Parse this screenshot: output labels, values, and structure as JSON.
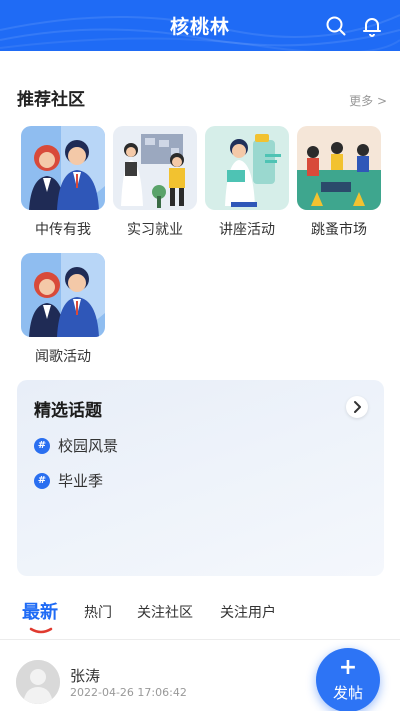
{
  "header": {
    "title": "核桃林"
  },
  "recommended": {
    "title": "推荐社区",
    "more": "更多 >",
    "items": [
      {
        "label": "中传有我"
      },
      {
        "label": "实习就业"
      },
      {
        "label": "讲座活动"
      },
      {
        "label": "跳蚤市场"
      },
      {
        "label": "闻歌活动"
      }
    ]
  },
  "topics": {
    "title": "精选话题",
    "items": [
      {
        "label": "校园风景"
      },
      {
        "label": "毕业季"
      }
    ]
  },
  "tabs": [
    {
      "label": "最新",
      "active": true
    },
    {
      "label": "热门"
    },
    {
      "label": "关注社区"
    },
    {
      "label": "关注用户"
    }
  ],
  "post": {
    "author": "张涛",
    "time": "2022-04-26 17:06:42"
  },
  "fab": {
    "plus": "+",
    "label": "发帖"
  },
  "colors": {
    "brand": "#1f6bf5",
    "hash_badge": "#2a6ff0",
    "background": "#ffffff"
  }
}
